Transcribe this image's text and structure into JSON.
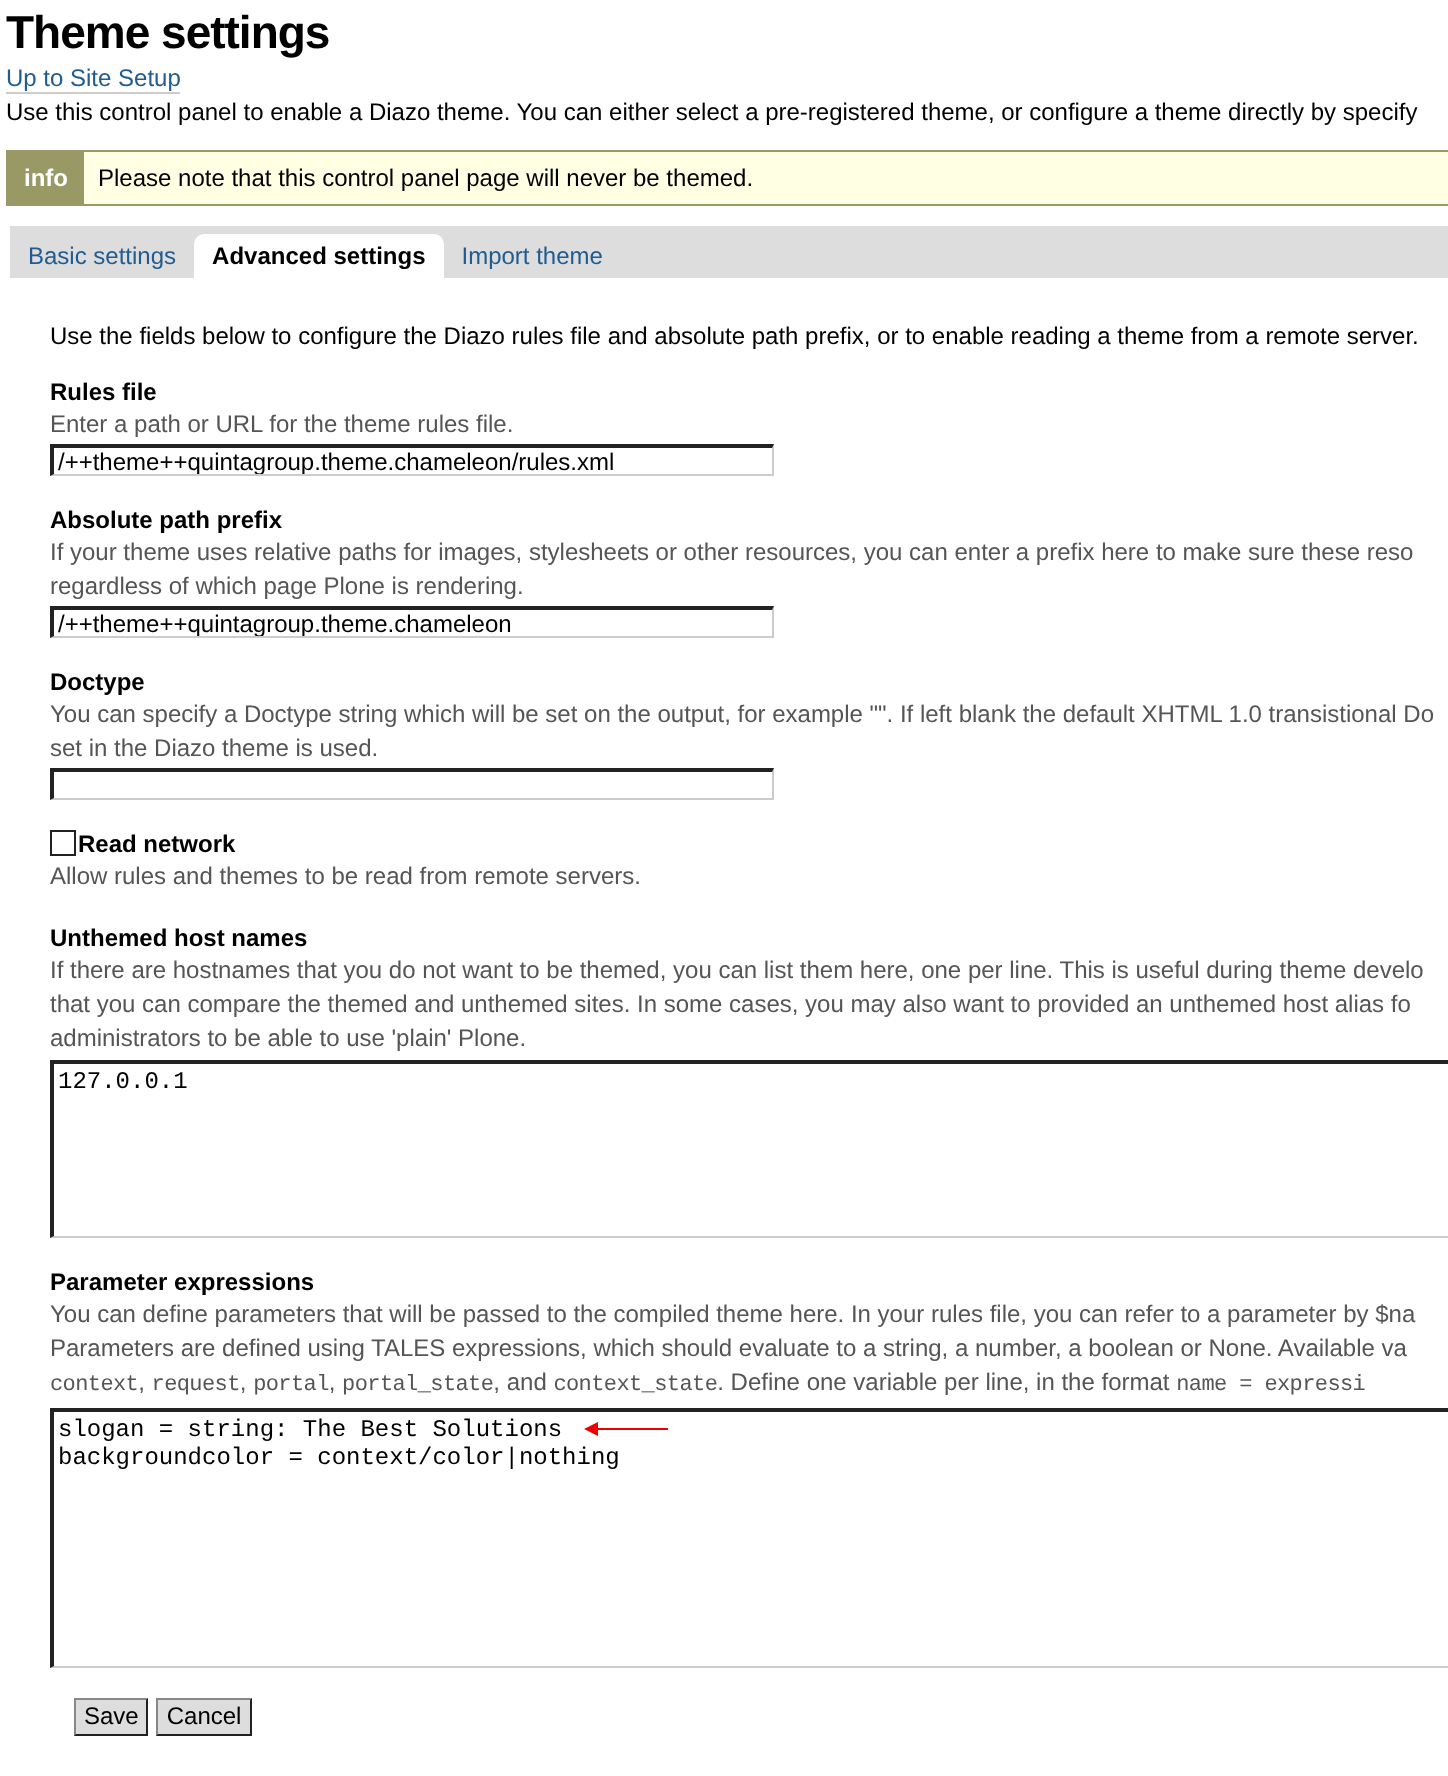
{
  "title": "Theme settings",
  "back_link": "Up to Site Setup",
  "intro": "Use this control panel to enable a Diazo theme. You can either select a pre-registered theme, or configure a theme directly by specify",
  "info": {
    "label": "info",
    "text": "Please note that this control panel page will never be themed."
  },
  "tabs": [
    {
      "label": "Basic settings",
      "selected": false
    },
    {
      "label": "Advanced settings",
      "selected": true
    },
    {
      "label": "Import theme",
      "selected": false
    }
  ],
  "panel_intro": "Use the fields below to configure the Diazo rules file and absolute path prefix, or to enable reading a theme from a remote server.",
  "fields": [
    {
      "kind": "text",
      "label": "Rules file",
      "help": [
        [
          {
            "text": "Enter a path or URL for the theme rules file."
          }
        ]
      ],
      "entered_text": "/++theme++quintagroup.theme.chameleon/rules.xml"
    },
    {
      "kind": "text",
      "label": "Absolute path prefix",
      "help": [
        [
          {
            "text": "If your theme uses relative paths for images, stylesheets or other resources, you can enter a prefix here to make sure these reso"
          }
        ],
        [
          {
            "text": "regardless of which page Plone is rendering."
          }
        ]
      ],
      "entered_text": "/++theme++quintagroup.theme.chameleon"
    },
    {
      "kind": "text",
      "label": "Doctype",
      "help": [
        [
          {
            "text": "You can specify a Doctype string which will be set on the output, for example \"\". If left blank the default XHTML 1.0 transistional Do"
          }
        ],
        [
          {
            "text": "set in the Diazo theme is used."
          }
        ]
      ]
    },
    {
      "kind": "checkbox",
      "label": "Read network",
      "checked": false,
      "help": [
        [
          {
            "text": "Allow rules and themes to be read from remote servers."
          }
        ]
      ]
    },
    {
      "kind": "textarea",
      "label": "Unthemed host names",
      "help": [
        [
          {
            "text": "If there are hostnames that you do not want to be themed, you can list them here, one per line. This is useful during theme develo"
          }
        ],
        [
          {
            "text": "that you can compare the themed and unthemed sites. In some cases, you may also want to provided an unthemed host alias fo"
          }
        ],
        [
          {
            "text": "administrators to be able to use 'plain' Plone."
          }
        ]
      ],
      "lines": [
        {
          "text": "127.0.0.1",
          "marked": false
        }
      ]
    },
    {
      "kind": "textarea",
      "label": "Parameter expressions",
      "help": [
        [
          {
            "text": "You can define parameters that will be passed to the compiled theme here. In your rules file, you can refer to a parameter by $na"
          }
        ],
        [
          {
            "text": "Parameters are defined using TALES expressions, which should evaluate to a string, a number, a boolean or None. Available va"
          }
        ],
        [
          {
            "text": "context",
            "code": true
          },
          {
            "text": ", "
          },
          {
            "text": "request",
            "code": true
          },
          {
            "text": ", "
          },
          {
            "text": "portal",
            "code": true
          },
          {
            "text": ", "
          },
          {
            "text": "portal_state",
            "code": true
          },
          {
            "text": ", and "
          },
          {
            "text": "context_state",
            "code": true
          },
          {
            "text": ". Define one variable per line, in the format "
          },
          {
            "text": "name = expressi",
            "code": true
          }
        ]
      ],
      "lines": [
        {
          "text": "slogan = string: The Best Solutions",
          "marked": true
        },
        {
          "text": "backgroundcolor = context/color|nothing",
          "marked": false
        }
      ]
    }
  ],
  "buttons": [
    "Save",
    "Cancel"
  ]
}
